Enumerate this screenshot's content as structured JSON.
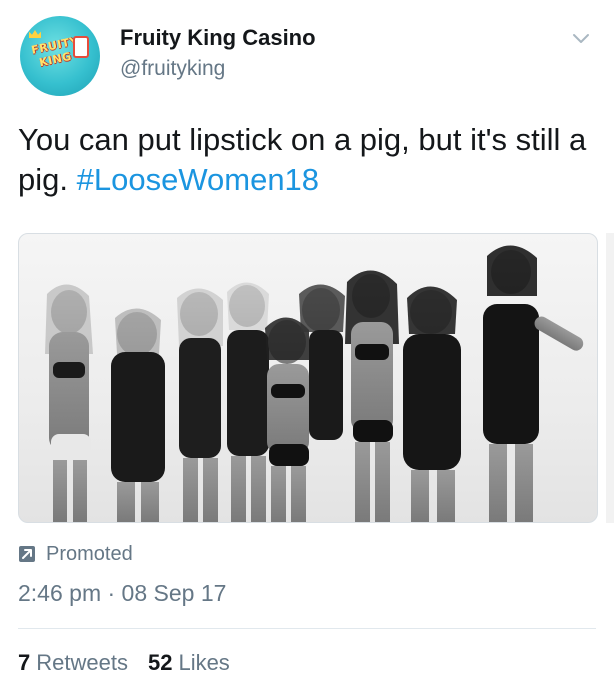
{
  "header": {
    "display_name": "Fruity King Casino",
    "handle": "@fruityking",
    "avatar_line1": "FRUITY",
    "avatar_line2": "KING",
    "avatar_icon": "fruity-king-logo",
    "menu_icon": "chevron-down-icon"
  },
  "tweet": {
    "text": "You can put lipstick on a pig, but it's still a pig.",
    "hashtag": "#LooseWomen18",
    "media_description_icon": "photo"
  },
  "meta": {
    "promoted_label": "Promoted",
    "promoted_icon": "promoted-arrow-icon",
    "timestamp": "2:46 pm · 08 Sep 17"
  },
  "stats": {
    "retweets_count": "7",
    "retweets_label": "Retweets",
    "likes_count": "52",
    "likes_label": "Likes"
  },
  "colors": {
    "link": "#1b95e0",
    "secondary_text": "#657786",
    "primary_text": "#14171a",
    "avatar_bg": "#36c0cf"
  }
}
